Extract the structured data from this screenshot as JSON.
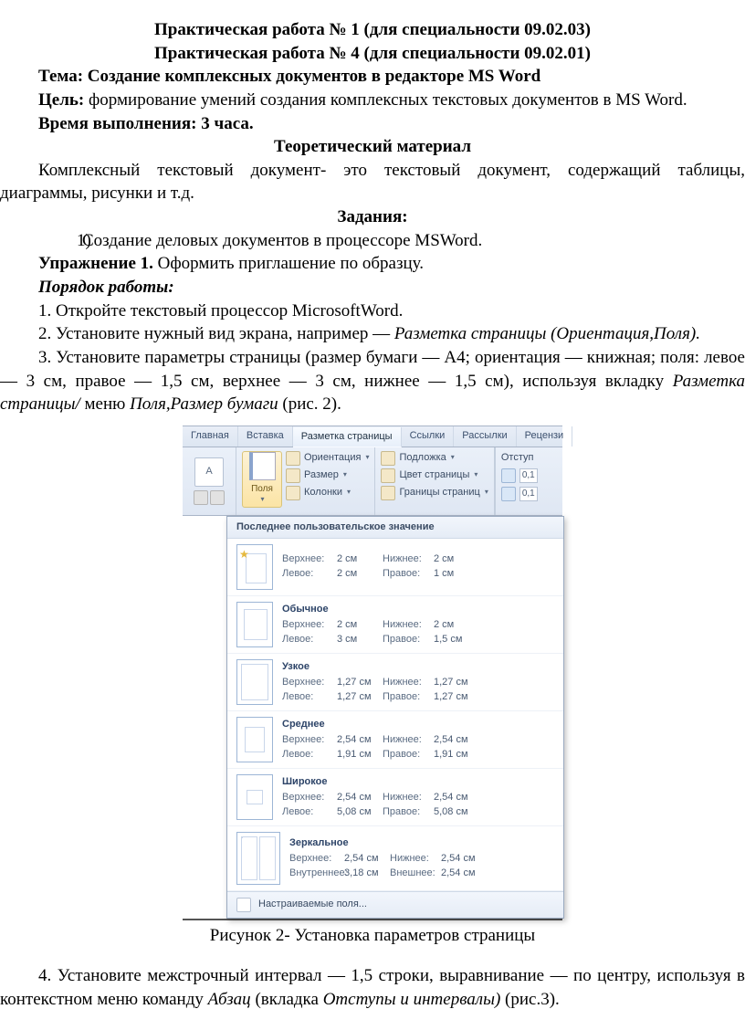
{
  "heading1": "Практическая работа № 1 (для специальности 09.02.03)",
  "heading2": "Практическая работа № 4 (для специальности 09.02.01)",
  "topic_label": "Тема:",
  "topic_text": " Создание комплексных документов в редакторе MS Word",
  "goal_label": "Цель:",
  "goal_text": " формирование умений создания комплексных текстовых документов в MS Word.",
  "time": "Время выполнения: 3 часа.",
  "theory": "Теоретический материал",
  "theory_body": "Комплексный текстовый документ- это текстовый документ, содержащий таблицы, диаграммы, рисунки и т.д.",
  "tasks": "Задания:",
  "task1_idx": "1)",
  "task1": "Создание деловых документов в процессоре MSWord.",
  "ex_label": "Упражнение 1.",
  "ex_text": " Оформить приглашение по образцу.",
  "order": "Порядок работы:",
  "s1": "1. Откройте текстовый процессор MicrosoftWord.",
  "s2a": "2. Установите нужный вид экрана, например — ",
  "s2b": "Разметка страницы (Ориентация,Поля).",
  "s3a": "3. Установите параметры страницы (размер бумаги — А4; ориентация — книжная; поля: левое — 3 см, правое — 1,5 см, верхнее — 3 см, нижнее — 1,5 см), используя вкладку ",
  "s3b": "Разметка страницы/",
  "s3c": " меню ",
  "s3d": "Поля,Размер бумаги",
  "s3e": " (рис. 2).",
  "caption": "Рисунок 2- Установка параметров страницы",
  "s4a": "4. Установите межстрочный интервал — 1,5 строки, выравнивание — по центру, используя в контекстном меню команду ",
  "s4b": "Абзац",
  "s4c": " (вкладка ",
  "s4d": "Отступы и интервалы)",
  "s4e": " (рис.3).",
  "tabs": [
    "Главная",
    "Вставка",
    "Разметка страницы",
    "Ссылки",
    "Рассылки",
    "Рецензи"
  ],
  "ribbon": {
    "big": "Поля",
    "left_btn": "A",
    "c1": [
      "Ориентация",
      "Размер",
      "Колонки"
    ],
    "c2": [
      "Подложка",
      "Цвет страницы",
      "Границы страниц"
    ],
    "c3_label": "Отступ",
    "c3_val": "0,1"
  },
  "dd_head": "Последнее пользовательское значение",
  "labels": {
    "top": "Верхнее:",
    "bottom": "Нижнее:",
    "left": "Левое:",
    "right": "Правое:",
    "inner": "Внутреннее:",
    "outer": "Внешнее:"
  },
  "presets": [
    {
      "name": "",
      "top": "2 см",
      "bottom": "2 см",
      "left": "2 см",
      "right": "1 см",
      "cls": "th-last",
      "star": true
    },
    {
      "name": "Обычное",
      "top": "2 см",
      "bottom": "2 см",
      "left": "3 см",
      "right": "1,5 см",
      "cls": "th-norm"
    },
    {
      "name": "Узкое",
      "top": "1,27 см",
      "bottom": "1,27 см",
      "left": "1,27 см",
      "right": "1,27 см",
      "cls": "th-narrow"
    },
    {
      "name": "Среднее",
      "top": "2,54 см",
      "bottom": "2,54 см",
      "left": "1,91 см",
      "right": "1,91 см",
      "cls": "th-mod"
    },
    {
      "name": "Широкое",
      "top": "2,54 см",
      "bottom": "2,54 см",
      "left": "5,08 см",
      "right": "5,08 см",
      "cls": "th-wide"
    },
    {
      "name": "Зеркальное",
      "top": "2,54 см",
      "bottom": "2,54 см",
      "left": "3,18 см",
      "right": "2,54 см",
      "cls": "th-mirror",
      "mirror": true
    }
  ],
  "dd_foot": "Настраиваемые поля..."
}
